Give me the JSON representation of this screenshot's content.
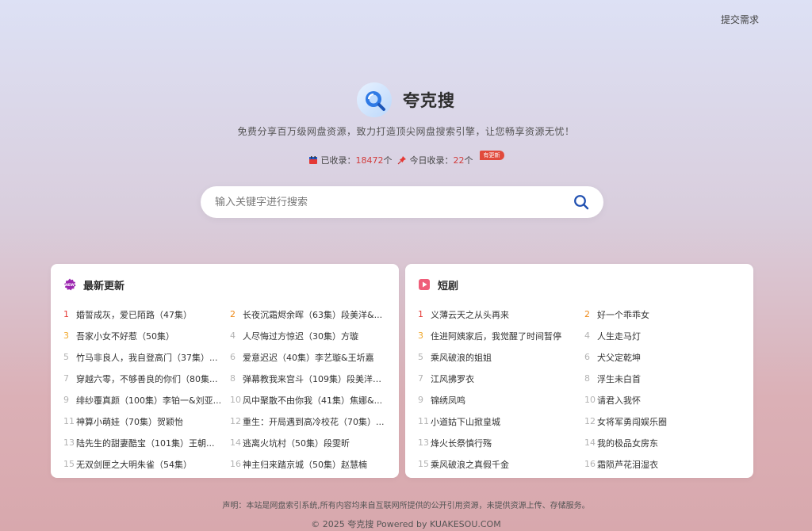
{
  "header": {
    "submit_request": "提交需求"
  },
  "brand": {
    "name": "夸克搜",
    "tagline": "免费分享百万级网盘资源，致力打造顶尖网盘搜索引擎，让您畅享资源无忧！"
  },
  "stats": {
    "collected_label": "已收录：",
    "collected_value": "18472",
    "unit": "个",
    "today_label": "今日收录：",
    "today_value": "22",
    "badge": "有更新"
  },
  "search": {
    "placeholder": "输入关键字进行搜索"
  },
  "latest": {
    "title": "最新更新",
    "items": [
      {
        "rank": "1",
        "text": "婚誓成灰，爱已陌路（47集）"
      },
      {
        "rank": "2",
        "text": "长夜沉霜烬余晖（63集）段美洋&..."
      },
      {
        "rank": "3",
        "text": "吾家小女不好惹（50集）"
      },
      {
        "rank": "4",
        "text": "人尽悔过方惊迟（30集）方璇"
      },
      {
        "rank": "5",
        "text": "竹马非良人，我自登高门（37集）..."
      },
      {
        "rank": "6",
        "text": "爱意迟迟（40集）李艺璇&王圻嘉"
      },
      {
        "rank": "7",
        "text": "穿越六零，不够善良的你们（80集..."
      },
      {
        "rank": "8",
        "text": "弹幕教我来宫斗（109集）段美洋&..."
      },
      {
        "rank": "9",
        "text": "绯纱覆真颜（100集）李铂一&刘亚..."
      },
      {
        "rank": "10",
        "text": "风中聚散不由你我（41集）焦娜&..."
      },
      {
        "rank": "11",
        "text": "神算小萌娃（70集）贺颖怡"
      },
      {
        "rank": "12",
        "text": "重生：开局遇到高冷校花（70集）..."
      },
      {
        "rank": "13",
        "text": "陆先生的甜妻酷宝（101集）王朝..."
      },
      {
        "rank": "14",
        "text": "逃离火坑村（50集）段雯昕"
      },
      {
        "rank": "15",
        "text": "无双剑匣之大明朱雀（54集）"
      },
      {
        "rank": "16",
        "text": "神主归来踏京城（50集）赵慧楠"
      }
    ]
  },
  "drama": {
    "title": "短剧",
    "items": [
      {
        "rank": "1",
        "text": "义薄云天之从头再来"
      },
      {
        "rank": "2",
        "text": "好一个乖乖女"
      },
      {
        "rank": "3",
        "text": "住进阿姨家后，我觉醒了时间暂停"
      },
      {
        "rank": "4",
        "text": "人生走马灯"
      },
      {
        "rank": "5",
        "text": "乘风破浪的姐姐"
      },
      {
        "rank": "6",
        "text": "犬父定乾坤"
      },
      {
        "rank": "7",
        "text": "江风拂罗衣"
      },
      {
        "rank": "8",
        "text": "浮生未白首"
      },
      {
        "rank": "9",
        "text": "锦绣凤鸣"
      },
      {
        "rank": "10",
        "text": "请君入我怀"
      },
      {
        "rank": "11",
        "text": "小道姑下山掀皇城"
      },
      {
        "rank": "12",
        "text": "女将军勇闯娱乐圈"
      },
      {
        "rank": "13",
        "text": "烽火长祭慎行殇"
      },
      {
        "rank": "14",
        "text": "我的极品女房东"
      },
      {
        "rank": "15",
        "text": "乘风破浪之真假千金"
      },
      {
        "rank": "16",
        "text": "霜陨芦花泪湿衣"
      }
    ]
  },
  "footer": {
    "disclaimer": "声明：本站是网盘索引系统,所有内容均来自互联网所提供的公开引用资源，未提供资源上传、存储服务。",
    "copyright": "© 2025 夸克搜 Powered by KUAKESOU.COM"
  },
  "colors": {
    "accent": "#1f58c9",
    "rank1": "#e53935",
    "rank2": "#ef8a1a",
    "rank3": "#f0a72a",
    "badge": "#e14a3c"
  },
  "icons": {
    "logo": "magnifier-logo-icon",
    "latest": "new-badge-icon",
    "drama": "play-icon"
  }
}
